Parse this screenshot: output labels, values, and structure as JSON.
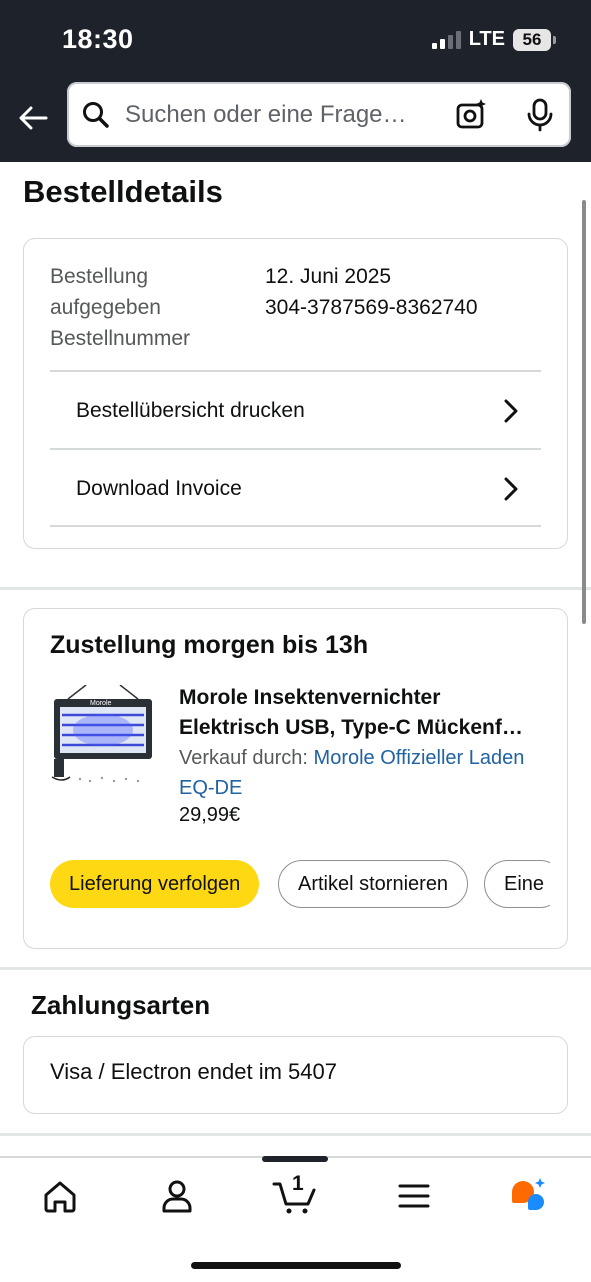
{
  "status_bar": {
    "time": "18:30",
    "network": "LTE",
    "battery": "56"
  },
  "search": {
    "placeholder": "Suchen oder eine Frage…"
  },
  "page": {
    "title": "Bestelldetails"
  },
  "order": {
    "labels": [
      "Bestellung",
      "aufgegeben",
      "Bestellnummer"
    ],
    "date": "12. Juni 2025",
    "number": "304-3787569-8362740",
    "actions": [
      "Bestellübersicht drucken",
      "Download Invoice"
    ]
  },
  "delivery": {
    "heading": "Zustellung morgen bis 13h",
    "product_title_line1": "Morole Insektenvernichter",
    "product_title_line2": "Elektrisch USB, Type-C Mückenf…",
    "sold_by_label": "Verkauf durch:",
    "seller_line1": "Morole Offizieller Laden",
    "seller_line2": "EQ-DE",
    "price": "29,99€",
    "image_brand": "Morole",
    "buttons": [
      "Lieferung verfolgen",
      "Artikel stornieren",
      "Eine"
    ]
  },
  "payment": {
    "heading": "Zahlungsarten",
    "method": "Visa / Electron  endet im 5407"
  },
  "tabbar": {
    "cart_count": "1",
    "icons": [
      "home-icon",
      "account-icon",
      "cart-icon",
      "menu-icon",
      "ai-assistant-icon"
    ]
  },
  "colors": {
    "header": "#1e232b",
    "primary_button": "#ffd814",
    "link": "#2162a1"
  }
}
